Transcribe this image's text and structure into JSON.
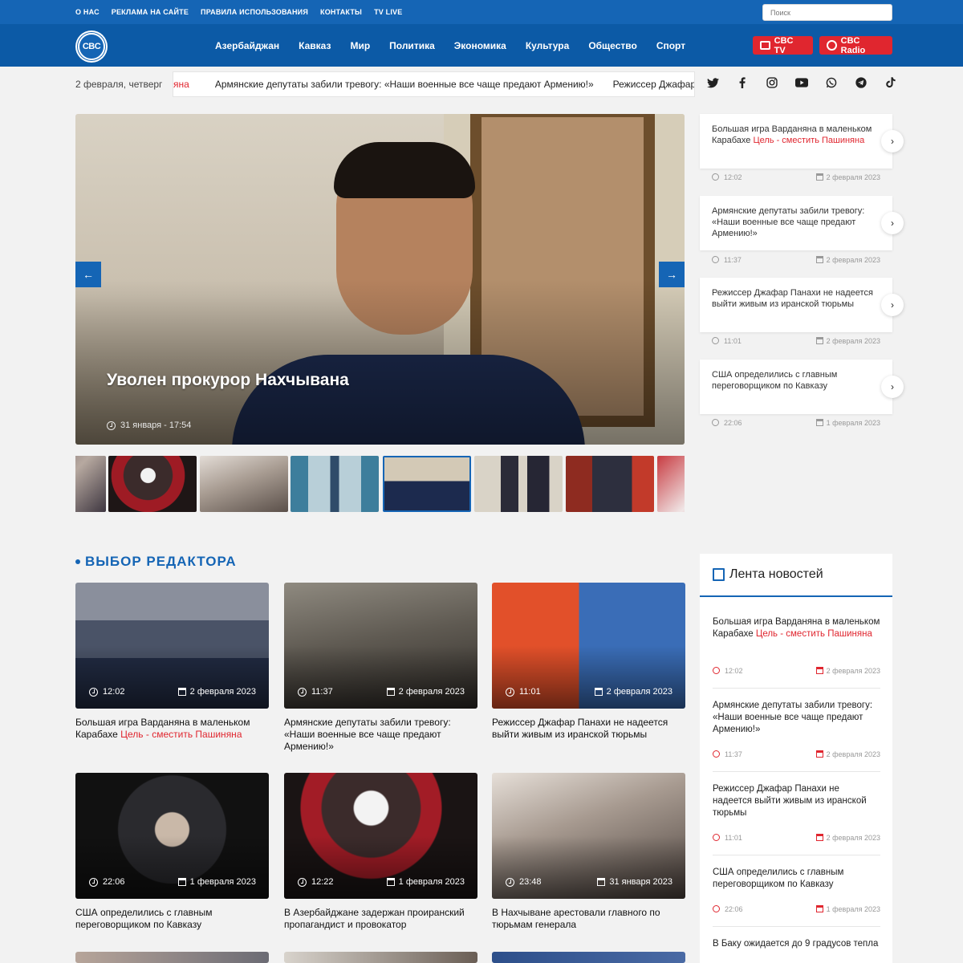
{
  "top_links": [
    "О НАС",
    "РЕКЛАМА НА САЙТЕ",
    "ПРАВИЛА ИСПОЛЬЗОВАНИЯ",
    "КОНТАКТЫ",
    "TV LIVE"
  ],
  "search": {
    "placeholder": "Поиск"
  },
  "logo": {
    "text": "CBC"
  },
  "menu": [
    "Азербайджан",
    "Кавказ",
    "Мир",
    "Политика",
    "Экономика",
    "Культура",
    "Общество",
    "Спорт"
  ],
  "live": {
    "tv": "CBC TV",
    "radio": "CBC Radio"
  },
  "date_text": "2 февраля, четверг",
  "ticker": {
    "partial": "яна",
    "item1": "Армянские депутаты забили тревогу: «Наши военные все чаще предают Армению!»",
    "item2": "Режиссер Джафар"
  },
  "socials": [
    "twitter-icon",
    "facebook-icon",
    "instagram-icon",
    "youtube-icon",
    "whatsapp-icon",
    "telegram-icon",
    "tiktok-icon"
  ],
  "hero": {
    "title": "Уволен прокурор Нахчывана",
    "meta": "31 января - 17:54",
    "prev_glyph": "←",
    "next_glyph": "→"
  },
  "side_list": [
    {
      "text": "Большая игра Варданяна в маленьком Карабахе ",
      "highlight": "Цель - сместить Пашиняна",
      "time": "12:02",
      "date": "2 февраля 2023"
    },
    {
      "text": "Армянские депутаты забили тревогу: «Наши военные все чаще предают Армению!»",
      "highlight": "",
      "time": "11:37",
      "date": "2 февраля 2023"
    },
    {
      "text": "Режиссер Джафар Панахи не надеется выйти живым из иранской тюрьмы",
      "highlight": "",
      "time": "11:01",
      "date": "2 февраля 2023"
    },
    {
      "text": "США определились с главным переговорщиком по Кавказу",
      "highlight": "",
      "time": "22:06",
      "date": "1 февраля 2023"
    }
  ],
  "editor": {
    "heading": "ВЫБОР РЕДАКТОРА",
    "cards": [
      {
        "title": "Большая игра Варданяна в маленьком Карабахе ",
        "highlight": "Цель - сместить Пашиняна",
        "time": "12:02",
        "date": "2 февраля 2023"
      },
      {
        "title": "Армянские депутаты забили тревогу: «Наши военные все чаще предают Армению!»",
        "highlight": "",
        "time": "11:37",
        "date": "2 февраля 2023"
      },
      {
        "title": "Режиссер Джафар Панахи не надеется выйти живым из иранской тюрьмы",
        "highlight": "",
        "time": "11:01",
        "date": "2 февраля 2023"
      },
      {
        "title": "США определились с главным переговорщиком по Кавказу",
        "highlight": "",
        "time": "22:06",
        "date": "1 февраля 2023"
      },
      {
        "title": "В Азербайджане задержан проиранский пропагандист и провокатор",
        "highlight": "",
        "time": "12:22",
        "date": "1 февраля 2023"
      },
      {
        "title": "В Нахчыване арестовали главного по тюрьмам генерала",
        "highlight": "",
        "time": "23:48",
        "date": "31 января 2023"
      }
    ]
  },
  "feed": {
    "title": "Лента новостей",
    "items": [
      {
        "text": "Большая игра Варданяна в маленьком Карабахе ",
        "highlight": "Цель - сместить Пашиняна",
        "time": "12:02",
        "date": "2 февраля 2023"
      },
      {
        "text": "Армянские депутаты забили тревогу: «Наши военные все чаще предают Армению!»",
        "highlight": "",
        "time": "11:37",
        "date": "2 февраля 2023"
      },
      {
        "text": "Режиссер Джафар Панахи не надеется выйти живым из иранской тюрьмы",
        "highlight": "",
        "time": "11:01",
        "date": "2 февраля 2023"
      },
      {
        "text": "США определились с главным переговорщиком по Кавказу",
        "highlight": "",
        "time": "22:06",
        "date": "1 февраля 2023"
      },
      {
        "text": "В Баку ожидается до 9 градусов тепла",
        "highlight": "",
        "time": "",
        "date": ""
      }
    ]
  },
  "colors": {
    "brand": "#1565b5",
    "nav": "#0c5aa6",
    "accent_red": "#e0262f"
  }
}
